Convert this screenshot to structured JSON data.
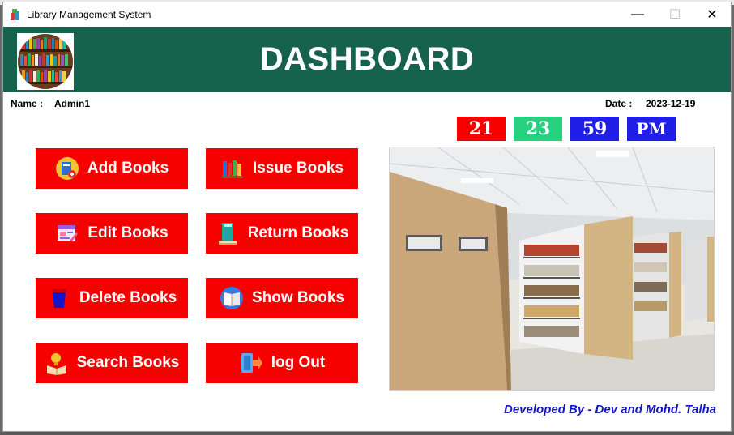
{
  "window": {
    "title": "Library Management System",
    "minimize": "—",
    "maximize": "☐",
    "close": "✕"
  },
  "header": {
    "title": "DASHBOARD"
  },
  "user": {
    "name_label": "Name :",
    "name_value": "Admin1"
  },
  "date": {
    "label": "Date :",
    "value": "2023-12-19"
  },
  "clock": {
    "hour": "21",
    "minute": "23",
    "second": "59",
    "period": "PM",
    "colors": {
      "hour": "#f70000",
      "minute": "#27d17f",
      "second": "#1f1fe8",
      "period": "#1f1fe8"
    }
  },
  "menu": {
    "add_books": {
      "label": "Add Books",
      "icon": "add-book-icon"
    },
    "issue_books": {
      "label": "Issue Books",
      "icon": "books-stack-icon"
    },
    "edit_books": {
      "label": "Edit Books",
      "icon": "edit-icon"
    },
    "return_books": {
      "label": "Return Books",
      "icon": "return-book-icon"
    },
    "delete_books": {
      "label": "Delete Books",
      "icon": "trash-icon"
    },
    "show_books": {
      "label": "Show Books",
      "icon": "open-book-icon"
    },
    "search_books": {
      "label": "Search Books",
      "icon": "search-book-icon"
    },
    "log_out": {
      "label": "log Out",
      "icon": "logout-icon"
    }
  },
  "footer": {
    "credit": "Developed By - Dev and Mohd. Talha"
  },
  "colors": {
    "header_bg": "#17624c",
    "button_bg": "#f70000",
    "footer_text": "#1515c8"
  }
}
